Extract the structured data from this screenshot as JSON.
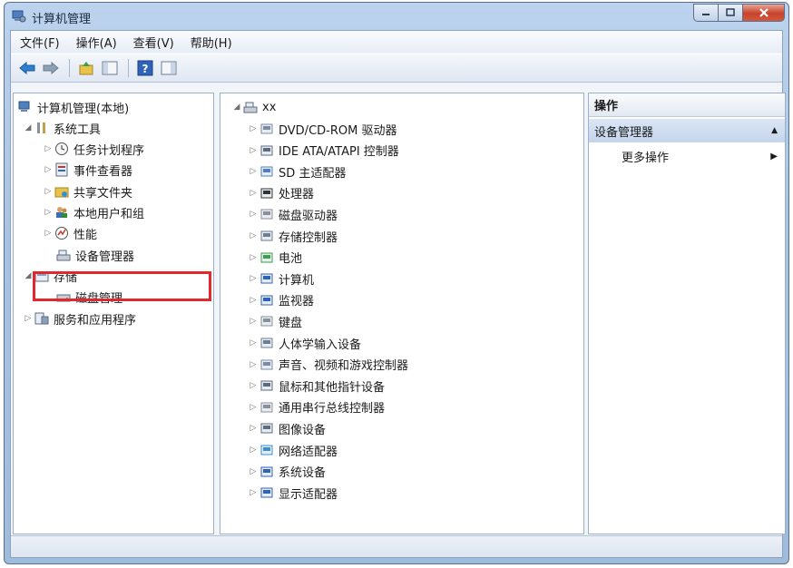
{
  "window": {
    "title": "计算机管理"
  },
  "menu": [
    "文件(F)",
    "操作(A)",
    "查看(V)",
    "帮助(H)"
  ],
  "left_tree": {
    "root": "计算机管理(本地)",
    "system_tools": "系统工具",
    "system_children": [
      "任务计划程序",
      "事件查看器",
      "共享文件夹",
      "本地用户和组",
      "性能",
      "设备管理器"
    ],
    "storage": "存储",
    "storage_children": [
      "磁盘管理"
    ],
    "services": "服务和应用程序",
    "selected": "设备管理器"
  },
  "device_tree": {
    "root": "xx",
    "categories": [
      "DVD/CD-ROM 驱动器",
      "IDE ATA/ATAPI 控制器",
      "SD 主适配器",
      "处理器",
      "磁盘驱动器",
      "存储控制器",
      "电池",
      "计算机",
      "监视器",
      "键盘",
      "人体学输入设备",
      "声音、视频和游戏控制器",
      "鼠标和其他指针设备",
      "通用串行总线控制器",
      "图像设备",
      "网络适配器",
      "系统设备",
      "显示适配器"
    ]
  },
  "actions": {
    "header": "操作",
    "section": "设备管理器",
    "more": "更多操作"
  },
  "colors": {
    "highlight": "#e2282c",
    "accent": "#3a6fb5"
  }
}
